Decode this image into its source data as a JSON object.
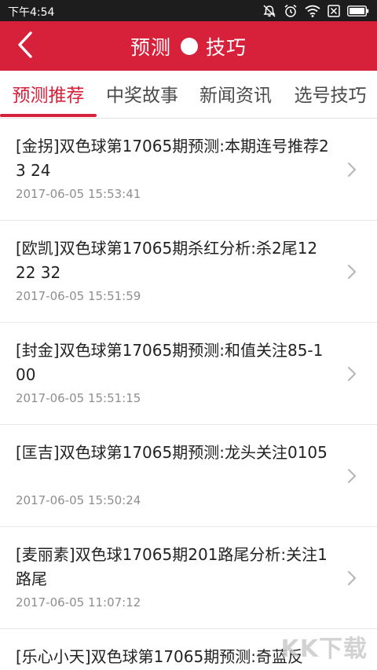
{
  "status_bar": {
    "time": "下午4:54"
  },
  "header": {
    "title_left": "预测",
    "title_right": "技巧"
  },
  "tabs": [
    {
      "label": "预测推荐",
      "active": true
    },
    {
      "label": "中奖故事",
      "active": false
    },
    {
      "label": "新闻资讯",
      "active": false
    },
    {
      "label": "选号技巧",
      "active": false
    }
  ],
  "news": [
    {
      "title": "[金拐]双色球第17065期预测:本期连号推荐23 24",
      "date": "2017-06-05 15:53:41"
    },
    {
      "title": "[欧凯]双色球第17065期杀红分析:杀2尾12 22 32",
      "date": "2017-06-05 15:51:59"
    },
    {
      "title": "[封金]双色球第17065期预测:和值关注85-100",
      "date": "2017-06-05 15:51:15"
    },
    {
      "title": "[匡吉]双色球第17065期预测:龙头关注0105",
      "date": "2017-06-05 15:50:24"
    },
    {
      "title": "[麦丽素]双色球17065期201路尾分析:关注1路尾",
      "date": "2017-06-05 11:07:12"
    },
    {
      "title": "[乐心小天]双色球第17065期预测:奇蓝反",
      "date": ""
    }
  ],
  "watermark": "KK下载",
  "colors": {
    "accent": "#d7203a",
    "status_bar": "#1d1d1d"
  }
}
